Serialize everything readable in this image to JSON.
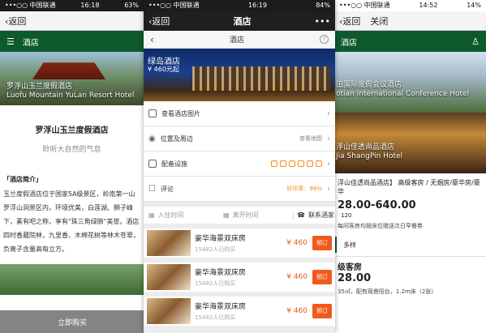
{
  "left": {
    "status": {
      "carrier": "•••○○ 中国联通",
      "time": "16:18",
      "battery": "63%"
    },
    "back_label": "返回",
    "section_title": "酒店",
    "hero_caption_cn": "罗浮山玉兰度假酒店",
    "hero_caption_en": "Luofu Mountain YuLan Resort Hotel",
    "hotel_name": "罗浮山玉兰度假酒店",
    "slogan": "聆听大自然的气息",
    "intro_heading": "「酒店简介」",
    "intro_body": "玉兰度假酒店位于国家5A级景区，岭南第一山罗浮山洞景区内，环境优美，白莲湖、狮子峰下，素有吧之称，享有\"珠三角绿肺\"美誉。酒店四时香葳院林，九里香、木棉花树等林木苍翠，负离子含量高每立方。",
    "buy_button": "立即购买"
  },
  "mid": {
    "status": {
      "carrier": "•••○○ 中国联通",
      "time": "16:19",
      "battery": "84%"
    },
    "back_label": "返回",
    "nav_title": "酒店",
    "more_dots": "•••",
    "sub_title": "酒店",
    "help_icon": "?",
    "hero_name": "绿岛酒店",
    "hero_price": "¥ 460元起",
    "rows": {
      "photos": "查看酒店图片",
      "location": "位置及周边",
      "map": "查看地图",
      "facilities": "配备设施",
      "reviews": "评论",
      "rating": "好评率：98%"
    },
    "dates": {
      "checkin": "入住时间",
      "checkout": "离开时间",
      "contact": "联系酒家"
    },
    "rooms": [
      {
        "name": "豪华海景双床房",
        "sold": "15482人已购买",
        "price": "¥ 460",
        "book": "预订"
      },
      {
        "name": "豪华海景双床房",
        "sold": "15482人已购买",
        "price": "¥ 460",
        "book": "预订"
      },
      {
        "name": "豪华海景双床房",
        "sold": "15482人已购买",
        "price": "¥ 460",
        "book": "预订"
      }
    ]
  },
  "right": {
    "status": {
      "carrier": "•••○○ 中国联通",
      "time": "14:52",
      "battery": "14%"
    },
    "back_label": "返回",
    "close_label": "关闭",
    "section_title": "酒店",
    "hero1_cn": "田国际度假会议酒店",
    "hero1_en": "otian International Conference Hotel",
    "hero2_cn": "浮山佳透尚品酒店",
    "hero2_en": "Jia ShangPin Hotel",
    "desc": "浮山佳透尚品酒店】 高级客房 / 无烟房/豪华房/豪华",
    "price_range": "28.00-640.00",
    "count": "120",
    "note": "每间客房均按床位赠送次日早餐券",
    "more_tag": "多样",
    "room_type": "级客房",
    "room_price": "28.00",
    "room_spec": "35㎡，配有观景阳台，1.2m床（2张）"
  }
}
